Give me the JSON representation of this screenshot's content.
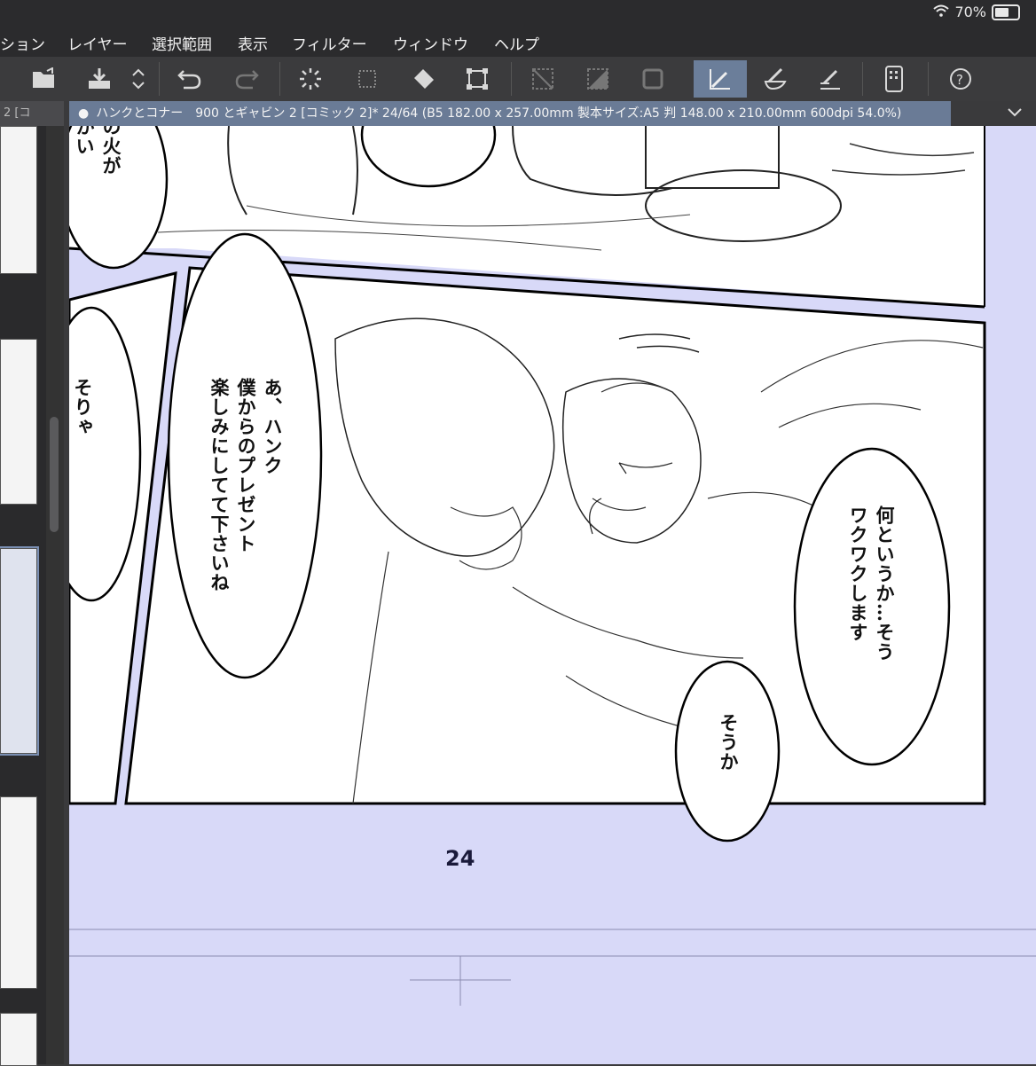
{
  "status": {
    "battery": "70%",
    "battery_level": 0.7
  },
  "menu": [
    "ション",
    "レイヤー",
    "選択範囲",
    "表示",
    "フィルター",
    "ウィンドウ",
    "ヘルプ"
  ],
  "toolbar": {
    "icons": [
      "chevron-left-icon",
      "open-folder-icon",
      "save-icon",
      "up-down-icon",
      "undo-icon",
      "redo-icon",
      "loading-icon",
      "select-dots-icon",
      "fill-icon",
      "transform-icon",
      "clear-icon",
      "fill-gray-icon",
      "border-icon",
      "pen-icon",
      "brush-icon",
      "eraser-icon",
      "smartphone-icon",
      "help-icon"
    ],
    "active": "pen-icon"
  },
  "tabs": {
    "left_tab": "2 [コ",
    "document": "ハンクとコナー　900 とギャビン 2 [コミック 2]* 24/64 (B5 182.00 x 257.00mm 製本サイズ:A5 判 148.00 x 210.00mm 600dpi 54.0%)"
  },
  "canvas": {
    "page_number": "24",
    "bubbles": {
      "top_left": "の火が\nかい",
      "left": "そりゃ",
      "center": "あ、ハンク\n僕からのプレゼント\n楽しみにしてて下さいね",
      "right": "何というか…そう\nワクワクします",
      "bottom": "そうか"
    }
  }
}
